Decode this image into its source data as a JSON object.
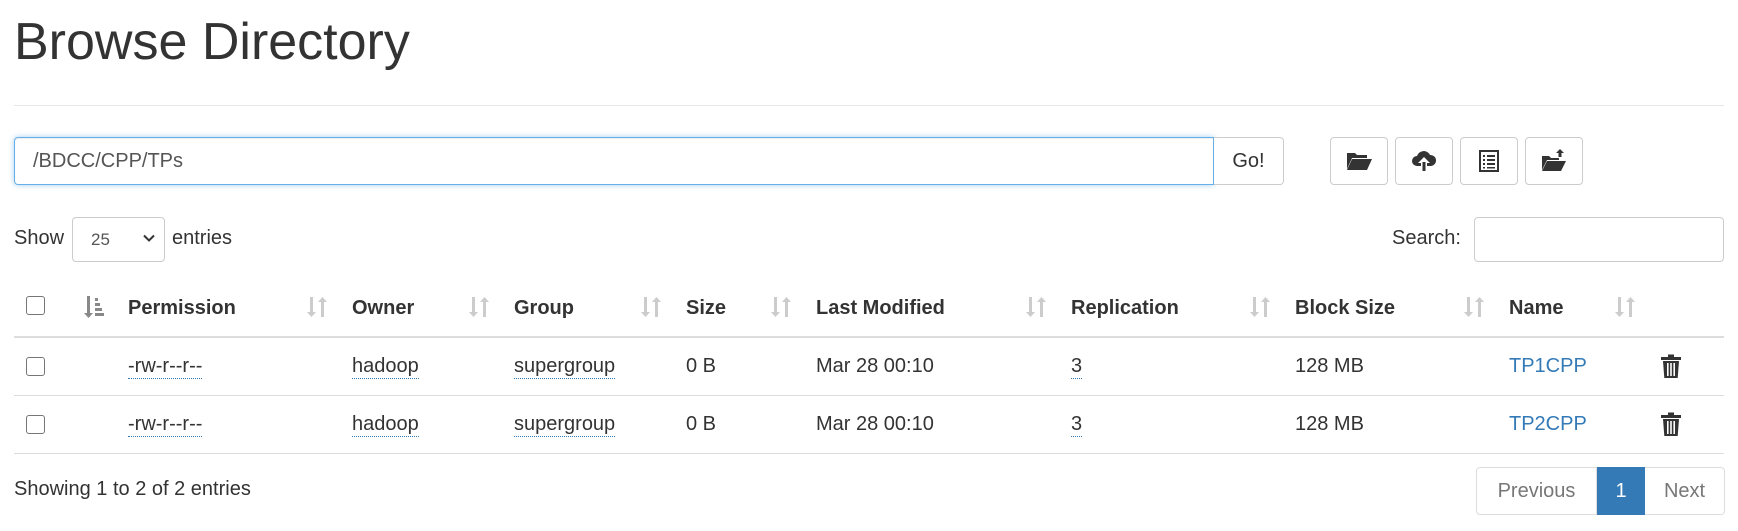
{
  "page": {
    "title": "Browse Directory"
  },
  "path_bar": {
    "value": "/BDCC/CPP/TPs",
    "go_label": "Go!"
  },
  "toolbar": {
    "icons": [
      "folder-open-icon",
      "cloud-upload-icon",
      "list-alt-icon",
      "folder-upload-icon"
    ]
  },
  "length_control": {
    "show_label": "Show",
    "selected": "25",
    "entries_label": "entries"
  },
  "search": {
    "label": "Search:",
    "value": ""
  },
  "table": {
    "columns": [
      "Permission",
      "Owner",
      "Group",
      "Size",
      "Last Modified",
      "Replication",
      "Block Size",
      "Name"
    ],
    "rows": [
      {
        "permission": "-rw-r--r--",
        "owner": "hadoop",
        "group": "supergroup",
        "size": "0 B",
        "last_modified": "Mar 28 00:10",
        "replication": "3",
        "block_size": "128 MB",
        "name": "TP1CPP"
      },
      {
        "permission": "-rw-r--r--",
        "owner": "hadoop",
        "group": "supergroup",
        "size": "0 B",
        "last_modified": "Mar 28 00:10",
        "replication": "3",
        "block_size": "128 MB",
        "name": "TP2CPP"
      }
    ]
  },
  "footer": {
    "info": "Showing 1 to 2 of 2 entries",
    "pagination": {
      "previous": "Previous",
      "current": "1",
      "next": "Next"
    }
  },
  "colors": {
    "link": "#337ab7",
    "active_page": "#337ab7",
    "focus_border": "#66afe9"
  }
}
